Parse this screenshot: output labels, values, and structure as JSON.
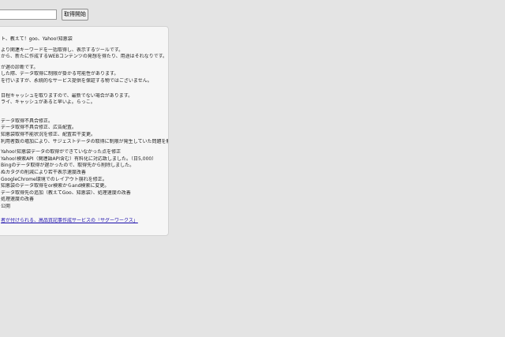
{
  "search": {
    "value": "",
    "placeholder": ""
  },
  "fetch_button": {
    "label": "取得開始"
  },
  "intro": [
    "ト、教えて！goo、Yahoo!知恵袋"
  ],
  "description": [
    "より関連キーワードを一括取得し、表示するツールです。",
    "から、新たに作成するWEBコンテンツの発想を得たり、用途はそれなりです。"
  ],
  "notes": [
    "が遅の診断です。",
    "した際、データ取得に制限が掛かる可能性があります。",
    "を行いますが、永続的なサービス提供を保証する物ではございません。"
  ],
  "cache_notes": [
    "日程キャッシュを取りますので、最新でない場合があります。",
    "ライ、キャッシュがあると早いよ。らっこ。"
  ],
  "changelog": [
    "データ取得不具合修正。",
    "データ取得不具合修正、広告配置。",
    "知恵袋取得不能状況を修正、配置若干変更。",
    "利用者数の増加により、サジェストデータの取得に制限が発生していた問題を解",
    "",
    "Yahoo!知恵袋データの取得ができていなかった点を修正",
    "Yahoo!検索API（関連語API含む）有料化に対応致しました。（日5,000）",
    "Bingのデータ取得が遅かったので、取得先から削除しました。",
    "ぬカタグの削減により若干表示速度改善",
    "GoogleChrome環境でのレイアウト崩れを修正。",
    "知恵袋のデータ取得をor検索からand検索に変更。",
    "データ取得先の追加（教えてGoo、知恵袋）、処理速度の改善",
    "処理速度の改善",
    "公開"
  ],
  "footer": {
    "link_text": "者が付けられる、高品質記事作成サービスの「サグーワークス」"
  }
}
